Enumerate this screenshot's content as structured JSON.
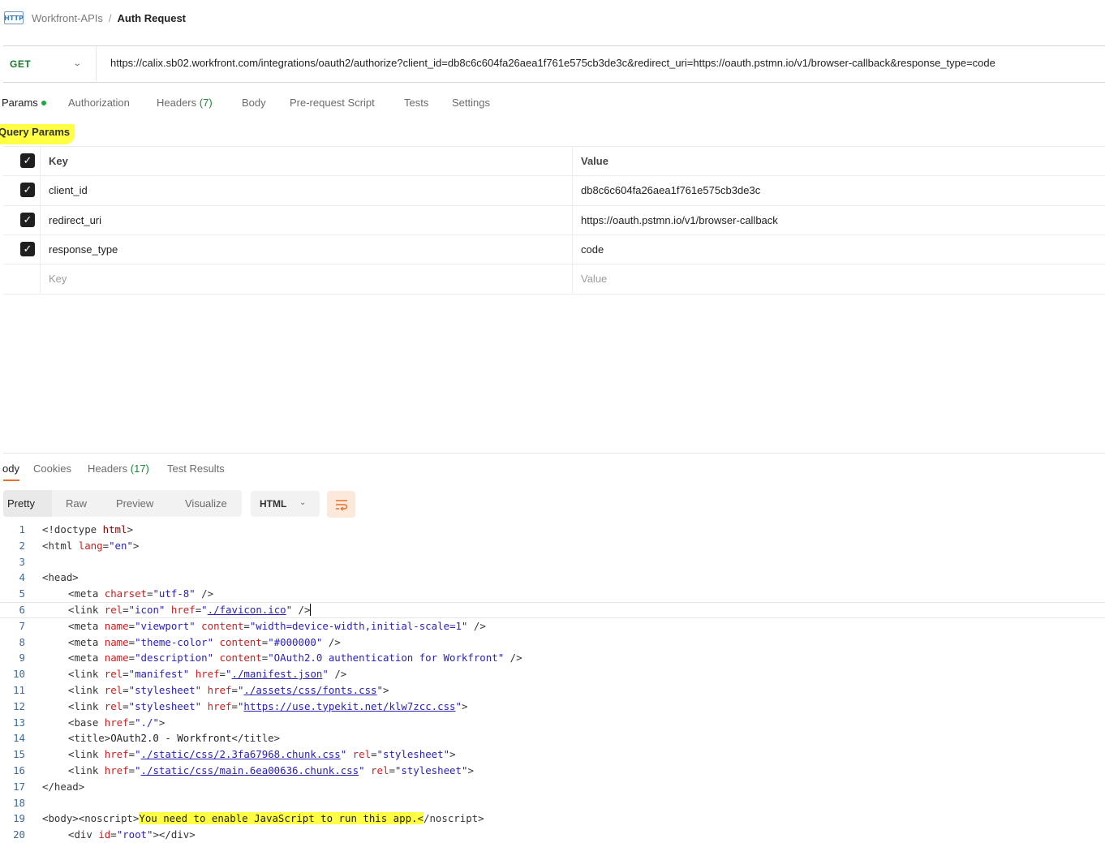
{
  "breadcrumb": {
    "icon_label": "HTTP",
    "collection": "Workfront-APIs",
    "separator": "/",
    "request_name": "Auth Request"
  },
  "url_bar": {
    "method": "GET",
    "url": "https://calix.sb02.workfront.com/integrations/oauth2/authorize?client_id=db8c6c604fa26aea1f761e575cb3de3c&redirect_uri=https://oauth.pstmn.io/v1/browser-callback&response_type=code"
  },
  "request_tabs": {
    "params": "Params",
    "authorization": "Authorization",
    "headers": "Headers",
    "headers_count": "(7)",
    "body": "Body",
    "prerequest": "Pre-request Script",
    "tests": "Tests",
    "settings": "Settings"
  },
  "query_params": {
    "title": "Query Params",
    "header": {
      "key": "Key",
      "value": "Value"
    },
    "rows": [
      {
        "key": "client_id",
        "value": "db8c6c604fa26aea1f761e575cb3de3c",
        "checked": true
      },
      {
        "key": "redirect_uri",
        "value": "https://oauth.pstmn.io/v1/browser-callback",
        "checked": true
      },
      {
        "key": "response_type",
        "value": "code",
        "checked": true
      }
    ],
    "placeholder": {
      "key": "Key",
      "value": "Value"
    }
  },
  "response_tabs": {
    "body": "Body",
    "cookies": "Cookies",
    "headers": "Headers",
    "headers_count": "(17)",
    "test_results": "Test Results"
  },
  "view_modes": {
    "pretty": "Pretty",
    "raw": "Raw",
    "preview": "Preview",
    "visualize": "Visualize",
    "format": "HTML",
    "wrap_icon": "wrap-lines-icon"
  },
  "code": {
    "line_numbers": [
      "1",
      "2",
      "3",
      "4",
      "5",
      "6",
      "7",
      "8",
      "9",
      "10",
      "11",
      "12",
      "13",
      "14",
      "15",
      "16",
      "17",
      "18",
      "19",
      "20"
    ],
    "l1": {
      "a": "<!doctype ",
      "b": "html",
      "c": ">"
    },
    "l2": {
      "a": "<html ",
      "b": "lang",
      "c": "=",
      "d": "\"en\"",
      "e": ">"
    },
    "l4": "<head>",
    "l5": {
      "a": "<meta ",
      "b": "charset",
      "c": "=",
      "d": "\"utf-8\"",
      "e": " />"
    },
    "l6": {
      "a": "<link ",
      "b": "rel",
      "c": "=",
      "d": "\"icon\"",
      "e": " ",
      "f": "href",
      "g": "=",
      "h": "\"",
      "i": "./favicon.ico",
      "j": "\"",
      "k": " />"
    },
    "l7": {
      "a": "<meta ",
      "b": "name",
      "c": "=",
      "d": "\"viewport\"",
      "e": " ",
      "f": "content",
      "g": "=",
      "h": "\"width=device-width,initial-scale=1\"",
      "i": " />"
    },
    "l8": {
      "a": "<meta ",
      "b": "name",
      "c": "=",
      "d": "\"theme-color\"",
      "e": " ",
      "f": "content",
      "g": "=",
      "h": "\"#000000\"",
      "i": " />"
    },
    "l9": {
      "a": "<meta ",
      "b": "name",
      "c": "=",
      "d": "\"description\"",
      "e": " ",
      "f": "content",
      "g": "=",
      "h": "\"OAuth2.0 authentication for Workfront\"",
      "i": " />"
    },
    "l10": {
      "a": "<link ",
      "b": "rel",
      "c": "=",
      "d": "\"manifest\"",
      "e": " ",
      "f": "href",
      "g": "=",
      "h": "\"",
      "i": "./manifest.json",
      "j": "\"",
      "k": " />"
    },
    "l11": {
      "a": "<link ",
      "b": "rel",
      "c": "=",
      "d": "\"stylesheet\"",
      "e": " ",
      "f": "href",
      "g": "=",
      "h": "\"",
      "i": "./assets/css/fonts.css",
      "j": "\"",
      "k": ">"
    },
    "l12": {
      "a": "<link ",
      "b": "rel",
      "c": "=",
      "d": "\"stylesheet\"",
      "e": " ",
      "f": "href",
      "g": "=",
      "h": "\"",
      "i": "https://use.typekit.net/klw7zcc.css",
      "j": "\"",
      "k": ">"
    },
    "l13": {
      "a": "<base ",
      "b": "href",
      "c": "=",
      "d": "\"./\"",
      "e": ">"
    },
    "l14": {
      "a": "<title>",
      "b": "OAuth2.0 - Workfront",
      "c": "</title>"
    },
    "l15": {
      "a": "<link ",
      "b": "href",
      "c": "=",
      "d": "\"",
      "e": "./static/css/2.3fa67968.chunk.css",
      "f": "\"",
      "g": " ",
      "h": "rel",
      "i": "=",
      "j": "\"stylesheet\"",
      "k": ">"
    },
    "l16": {
      "a": "<link ",
      "b": "href",
      "c": "=",
      "d": "\"",
      "e": "./static/css/main.6ea00636.chunk.css",
      "f": "\"",
      "g": " ",
      "h": "rel",
      "i": "=",
      "j": "\"stylesheet\"",
      "k": ">"
    },
    "l17": "</head>",
    "l19": {
      "a": "<body><noscript>",
      "b": "You need to enable JavaScript to run this app.",
      "c": "<",
      "d": "/noscript>"
    },
    "l20": {
      "a": "<div ",
      "b": "id",
      "c": "=",
      "d": "\"root\"",
      "e": "></div>"
    }
  }
}
